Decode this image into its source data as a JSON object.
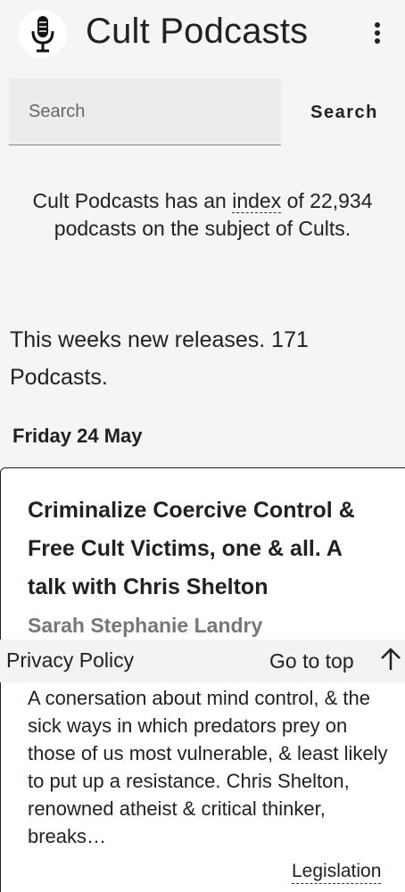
{
  "app": {
    "title": "Cult Podcasts",
    "logo_icon": "microphone-icon",
    "menu_icon": "more-vert-icon"
  },
  "search": {
    "placeholder": "Search",
    "value": "",
    "button_label": "Search"
  },
  "intro": {
    "prefix": "Cult Podcasts has an ",
    "link_text": "index",
    "suffix": " of 22,934 podcasts on the subject of Cults."
  },
  "weekly": {
    "text": "This weeks new releases. 171 Podcasts."
  },
  "date_heading": "Friday 24 May",
  "podcast_card": {
    "title": "Criminalize Coercive Control & Free Cult Victims, one & all. A talk with Chris Shelton",
    "author": "Sarah Stephanie Landry",
    "description": "A conersation about mind control, & the sick ways in which predators prey on those of us most vulnerable, & least likely to put up a resistance. Chris Shelton, renowned atheist & critical thinker, breaks…",
    "tag": "Legislation"
  },
  "footer": {
    "privacy_label": "Privacy Policy",
    "go_to_top_label": "Go to top",
    "go_to_top_icon": "arrow-up-icon"
  }
}
